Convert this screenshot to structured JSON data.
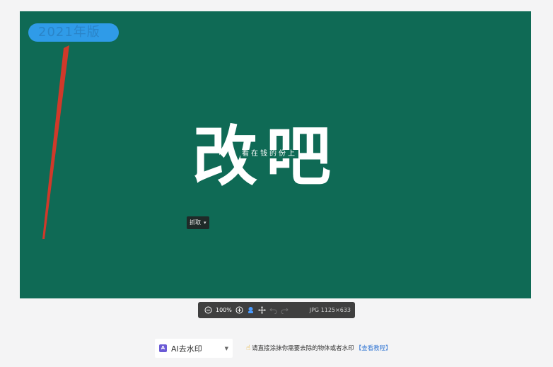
{
  "canvas": {
    "badge_text": "2021年版",
    "title": "改吧",
    "subtitle": "看在钱的份上",
    "capture_button_label": "抓取",
    "colors": {
      "canvas_bg": "#0f6a55",
      "badge_bg": "#2f9be8",
      "arrow": "#d0392a"
    }
  },
  "toolbar": {
    "zoom_level": "100%",
    "image_info": "JPG 1125×633",
    "icons": [
      "zoom-out-icon",
      "zoom-in-icon",
      "upload-icon",
      "move-icon",
      "undo-icon",
      "redo-icon"
    ]
  },
  "bottom_bar": {
    "mode_label": "AI去水印",
    "hint_text": "请直接涂抹你需要去除的物体或者水印",
    "hint_link": "【查看教程】"
  }
}
